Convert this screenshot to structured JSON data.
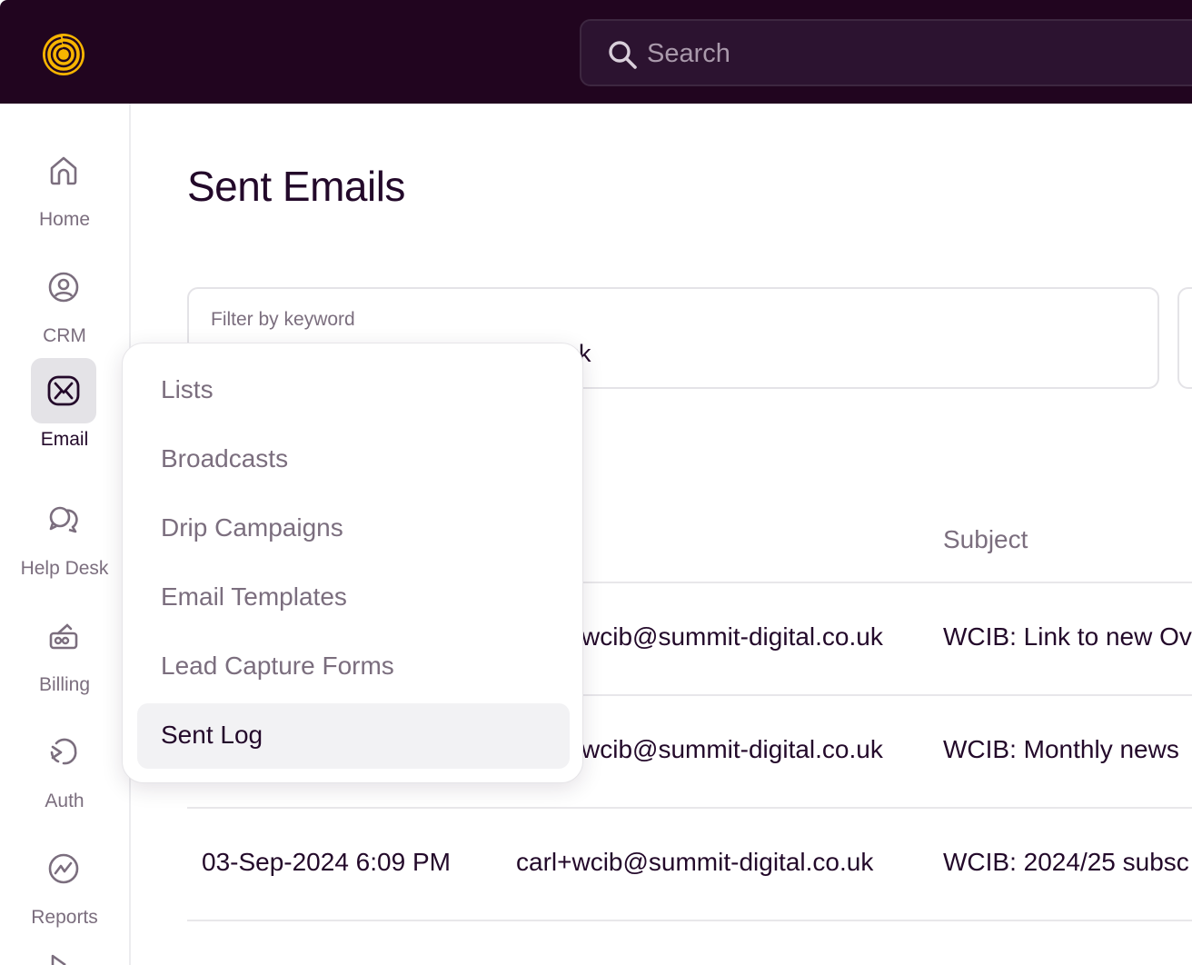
{
  "topbar": {
    "search_placeholder": "Search"
  },
  "sidebar": {
    "items": [
      {
        "label": "Home",
        "icon": "home-icon"
      },
      {
        "label": "CRM",
        "icon": "user-circle-icon"
      },
      {
        "label": "Email",
        "icon": "envelope-icon",
        "active": true
      },
      {
        "label": "Help Desk",
        "icon": "chat-bubbles-icon"
      },
      {
        "label": "Billing",
        "icon": "billing-icon"
      },
      {
        "label": "Auth",
        "icon": "auth-icon"
      },
      {
        "label": "Reports",
        "icon": "reports-icon"
      }
    ]
  },
  "main": {
    "title": "Sent Emails",
    "filter": {
      "label": "Filter by keyword",
      "value_visible": "uk"
    },
    "table": {
      "headers": [
        "Subject"
      ],
      "rows": [
        {
          "date": "",
          "recipient": "wcib@summit-digital.co.uk",
          "subject": "WCIB: Link to new Ov"
        },
        {
          "date": "",
          "recipient": "wcib@summit-digital.co.uk",
          "subject": "WCIB: Monthly news"
        },
        {
          "date": "03-Sep-2024 6:09 PM",
          "recipient": "carl+wcib@summit-digital.co.uk",
          "subject": "WCIB: 2024/25 subsc"
        }
      ]
    }
  },
  "email_menu": {
    "items": [
      "Lists",
      "Broadcasts",
      "Drip Campaigns",
      "Email Templates",
      "Lead Capture Forms",
      "Sent Log"
    ],
    "selected": "Sent Log"
  },
  "colors": {
    "topbar_bg": "#21051f",
    "brand_accent": "#f7b500",
    "text_primary": "#23092a",
    "text_muted": "#7b6e7e"
  }
}
